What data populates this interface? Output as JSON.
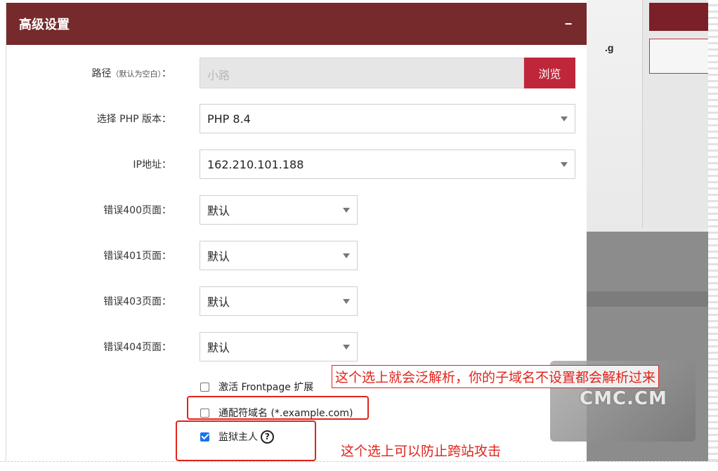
{
  "modal": {
    "title": "高级设置",
    "collapse": "−"
  },
  "form": {
    "path": {
      "label": "路径",
      "label_hint": "（默认为空白）",
      "label_colon": "：",
      "placeholder": "小路",
      "browse": "浏览"
    },
    "php_version": {
      "label": "选择 PHP 版本：",
      "value": "PHP 8.4"
    },
    "ip": {
      "label": "IP地址：",
      "value": "162.210.101.188"
    },
    "error400": {
      "label": "错误400页面：",
      "value": "默认"
    },
    "error401": {
      "label": "错误401页面：",
      "value": "默认"
    },
    "error403": {
      "label": "错误403页面：",
      "value": "默认"
    },
    "error404": {
      "label": "错误404页面：",
      "value": "默认"
    },
    "frontpage": {
      "label": "激活 Frontpage 扩展",
      "checked": false
    },
    "wildcard": {
      "label": "通配符域名 (*.example.com)",
      "checked": false
    },
    "jail": {
      "label": "监狱主人",
      "checked": true,
      "help": "?"
    }
  },
  "annotations": {
    "wildcard_note": "这个选上就会泛解析，你的子域名不设置都会解析过来",
    "jail_note": "这个选上可以防止跨站攻击"
  },
  "background": {
    "fragment_text": ".g"
  },
  "watermark": {
    "text": "CMC.CM"
  },
  "colors": {
    "header": "#772a2b",
    "browse_button": "#c0263a",
    "annotation": "#e0231c",
    "checkbox_checked": "#1a73e8"
  }
}
